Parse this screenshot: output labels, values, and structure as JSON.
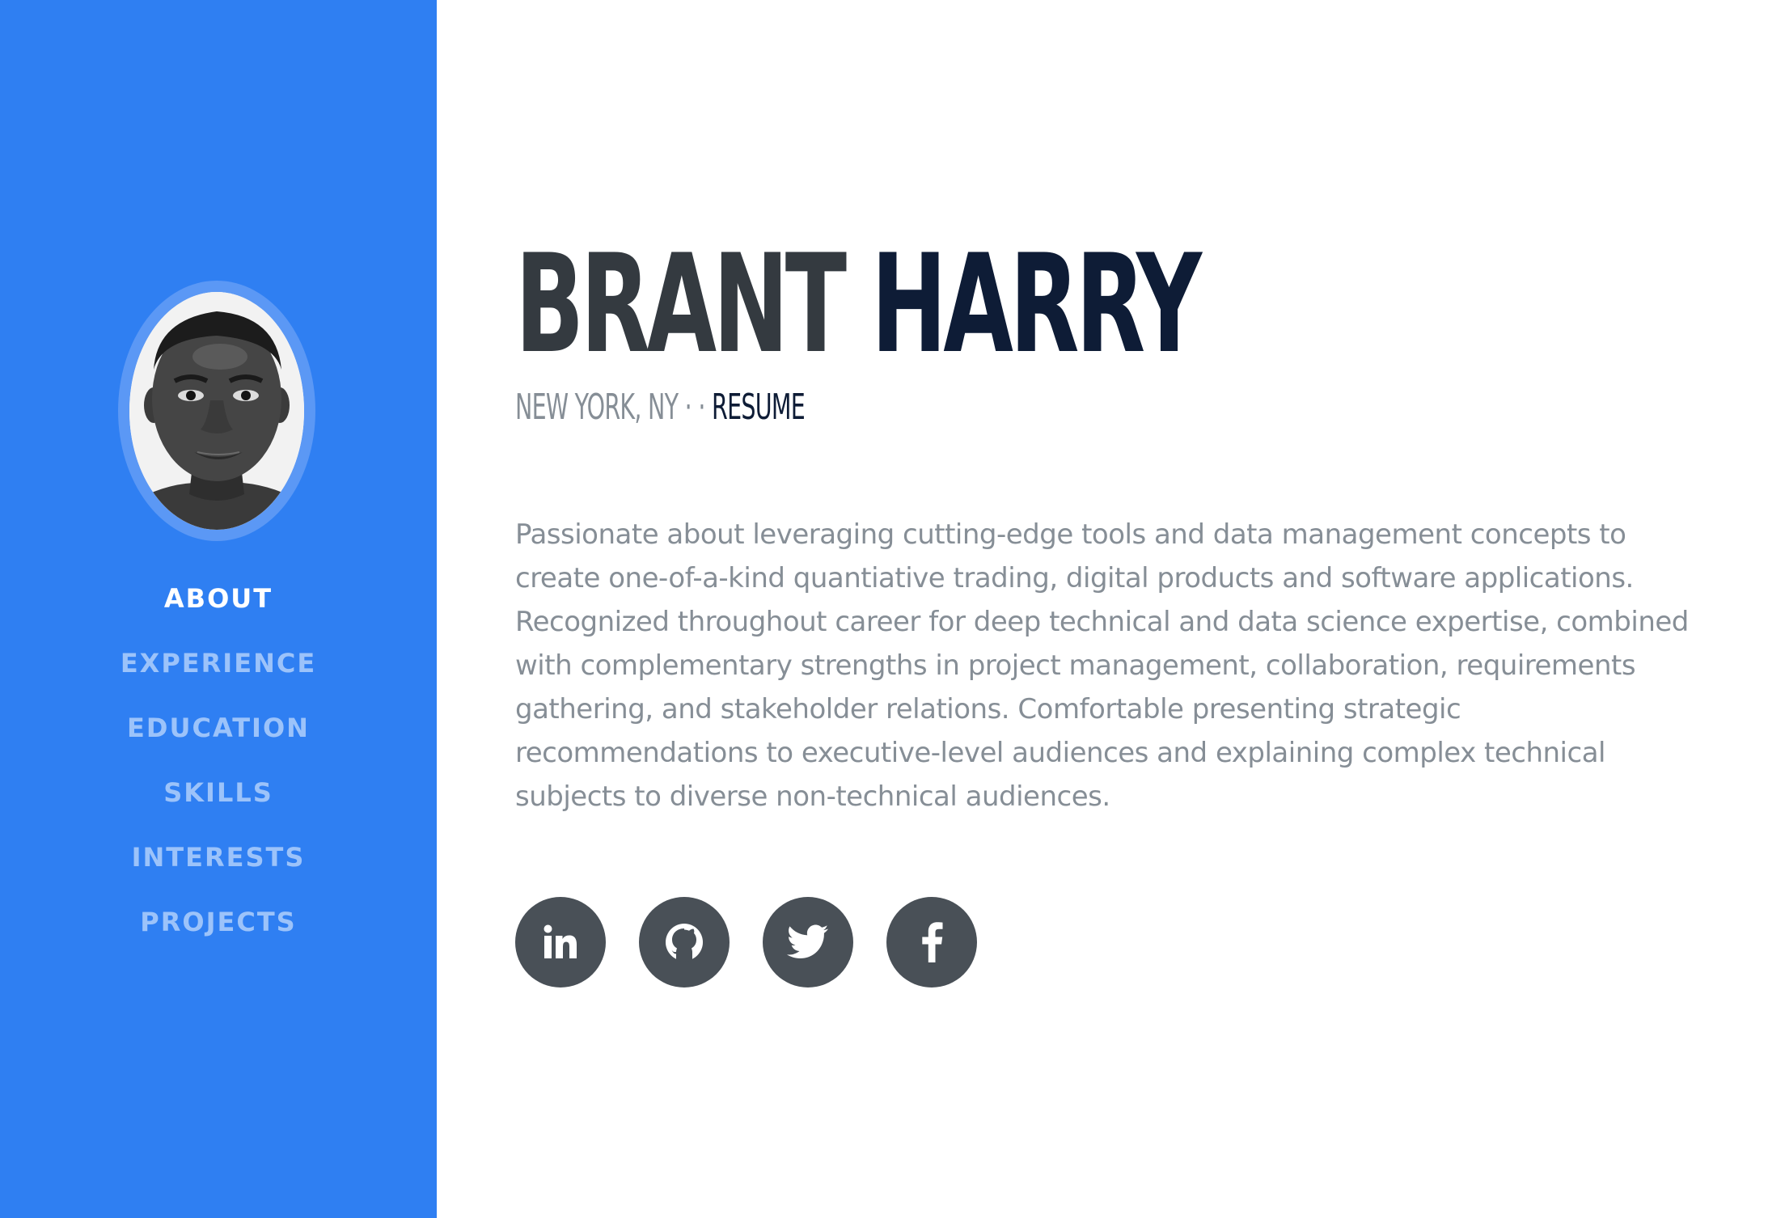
{
  "profile": {
    "first_name": "BRANT",
    "last_name": "HARRY",
    "location": "NEW YORK, NY",
    "separator": "· ·",
    "resume_label": "RESUME",
    "bio": "Passionate about leveraging cutting-edge tools and data management concepts to create one-of-a-kind quantiative trading, digital products and software applications. Recognized throughout career for deep technical and data science expertise, combined with complementary strengths in project management, collaboration, requirements gathering, and stakeholder relations. Comfortable presenting strategic recommendations to executive-level audiences and explaining complex technical subjects to diverse non-technical audiences."
  },
  "sidebar": {
    "avatar_icon": "profile-photo",
    "nav_items": [
      {
        "label": "ABOUT",
        "active": true
      },
      {
        "label": "EXPERIENCE",
        "active": false
      },
      {
        "label": "EDUCATION",
        "active": false
      },
      {
        "label": "SKILLS",
        "active": false
      },
      {
        "label": "INTERESTS",
        "active": false
      },
      {
        "label": "PROJECTS",
        "active": false
      }
    ]
  },
  "socials": [
    {
      "icon": "linkedin-icon"
    },
    {
      "icon": "github-icon"
    },
    {
      "icon": "twitter-icon"
    },
    {
      "icon": "facebook-icon"
    }
  ],
  "colors": {
    "sidebar_bg": "#2f7ff2",
    "nav_inactive": "#9cc3fa",
    "nav_active": "#ffffff",
    "name_first": "#343a40",
    "name_last": "#0e1c36",
    "body_text": "#868e96",
    "social_bg": "#495057"
  }
}
